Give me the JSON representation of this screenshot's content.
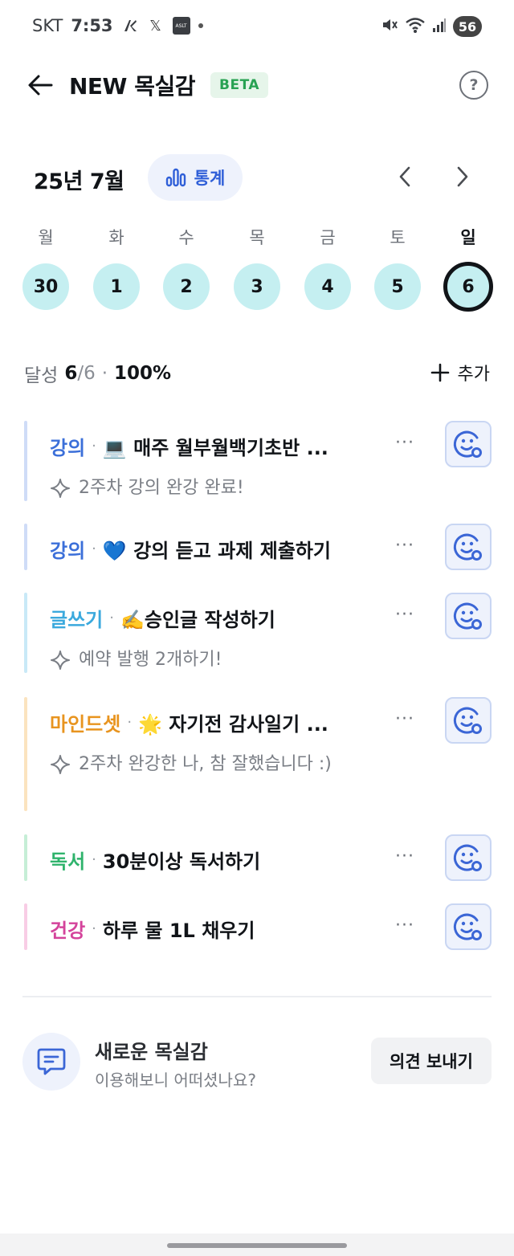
{
  "status_bar": {
    "carrier": "SKT",
    "time": "7:53",
    "battery": "56",
    "notif_x": "𝕏",
    "notif_app": "ASLT"
  },
  "header": {
    "title": "NEW 목실감",
    "badge": "BETA",
    "help": "?"
  },
  "calendar": {
    "month_label": "25년 7월",
    "stats_label": "통계",
    "weekdays": [
      "월",
      "화",
      "수",
      "목",
      "금",
      "토",
      "일"
    ],
    "dates": [
      "30",
      "1",
      "2",
      "3",
      "4",
      "5",
      "6"
    ],
    "selected_index": 6,
    "date_fill_color": "#c5eff1"
  },
  "summary": {
    "label": "달성",
    "done": "6",
    "total": "6",
    "percent": "100%",
    "add_label": "추가"
  },
  "tasks": [
    {
      "category": "강의",
      "title": "💻 매주 월부월백기초반 ...",
      "memo": "2주차 강의 완강 완료!",
      "color": "#3b6fd9",
      "bar": "#cfdcf7"
    },
    {
      "category": "강의",
      "title": "💙 강의 듣고 과제 제출하기",
      "memo": "",
      "color": "#3b6fd9",
      "bar": "#cfdcf7"
    },
    {
      "category": "글쓰기",
      "title": "✍️승인글 작성하기",
      "memo": "예약 발행 2개하기!",
      "color": "#3ba9dd",
      "bar": "#c9e9f7"
    },
    {
      "category": "마인드셋",
      "title": "🌟 자기전 감사일기 ...",
      "memo": "2주차 완강한 나, 참 잘했습니다 :)",
      "color": "#e8941f",
      "bar": "#fbe3bf"
    },
    {
      "category": "독서",
      "title": "30분이상 독서하기",
      "memo": "",
      "color": "#2fb36c",
      "bar": "#c6eed6"
    },
    {
      "category": "건강",
      "title": "하루 물 1L 채우기",
      "memo": "",
      "color": "#d4439b",
      "bar": "#f8cde5"
    }
  ],
  "more_label": "···",
  "feedback": {
    "title": "새로운 목실감",
    "subtitle": "이용해보니 어떠셨나요?",
    "button": "의견 보내기"
  }
}
